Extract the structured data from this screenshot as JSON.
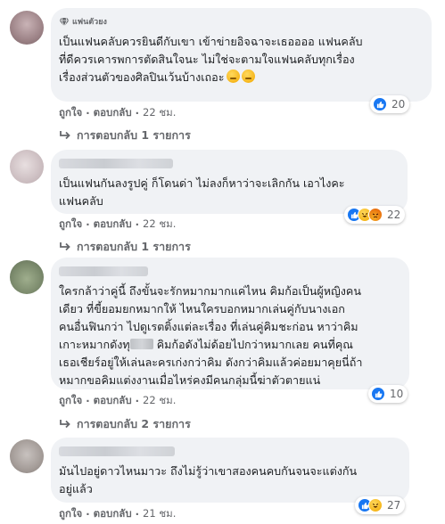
{
  "comments": [
    {
      "badge": "แฟนตัวยง",
      "text": "เป็นแฟนคลับควรยินดีกับเขา เข้าข่ายอิจฉาจะเธออออ แฟนคลับ\nที่ดีควรเคารพการตัดสินใจนะ ไม่ใช่จะตามใจแฟนคลับทุกเรื่อง\nเรื่องส่วนตัวของศิลปินเว้นบ้างเถอะ",
      "like": "ถูกใจ",
      "reply": "ตอบกลับ",
      "time": "22 ชม.",
      "reaction_count": "20",
      "replies_label": "การตอบกลับ 1 รายการ"
    },
    {
      "text": "เป็นแฟนกันลงรูปคู่ ก็โดนด่า ไม่ลงก็หาว่าจะเลิกกัน เอาไงคะ\nแฟนคลับ",
      "like": "ถูกใจ",
      "reply": "ตอบกลับ",
      "time": "22 ชม.",
      "reaction_count": "22",
      "replies_label": "การตอบกลับ 1 รายการ"
    },
    {
      "text_a": "ใครกล้าว่าคู่นี้ ถึงขั้นจะรักหมากมากแค่ไหน คิมก้อเป็นผู้หญิงคน\nเดียว ที่ขี้ยอมยกหมากให้ ไหนใครบอกหมากเล่นคู่กับนางเอก\nคนอื่นฟินกว่า ไปดูเรตติ้งแต่ละเรื่อง ที่เล่นคู่คิมชะก่อน หาว่าคิม\nเกาะหมากดังทุ",
      "text_b": " คิมก้อดังไม่ด้อยไปกว่าหมากเลย คนที่คุณ\nเธอเชียร์อยู่ให้เล่นละครเก่งกว่าคิม ดังกว่าคิมแล้วค่อยมาคุยนี่ถ้า\nหมากขอคิมแต่งงานเมื่อไหร่คงมีคนกลุ่มนี้ฆ่าตัวตายแน่",
      "like": "ถูกใจ",
      "reply": "ตอบกลับ",
      "time": "22 ชม.",
      "reaction_count": "10",
      "replies_label": "การตอบกลับ 2 รายการ"
    },
    {
      "text": "มันไปอยู่ดาวไหนมาวะ ถึงไม่รู้ว่าเขาสองคนคบกันจนจะแต่งกัน\nอยู่แล้ว",
      "like": "ถูกใจ",
      "reply": "ตอบกลับ",
      "time": "21 ชม.",
      "reaction_count": "27"
    }
  ],
  "colors": {
    "bubble": "#f0f2f5",
    "like_blue": "#1877f2",
    "meta_gray": "#65676b"
  },
  "icons": [
    "fan-badge-icon",
    "like-icon",
    "haha-icon",
    "angry-icon",
    "reply-arrow-icon",
    "grinning-emoji"
  ]
}
